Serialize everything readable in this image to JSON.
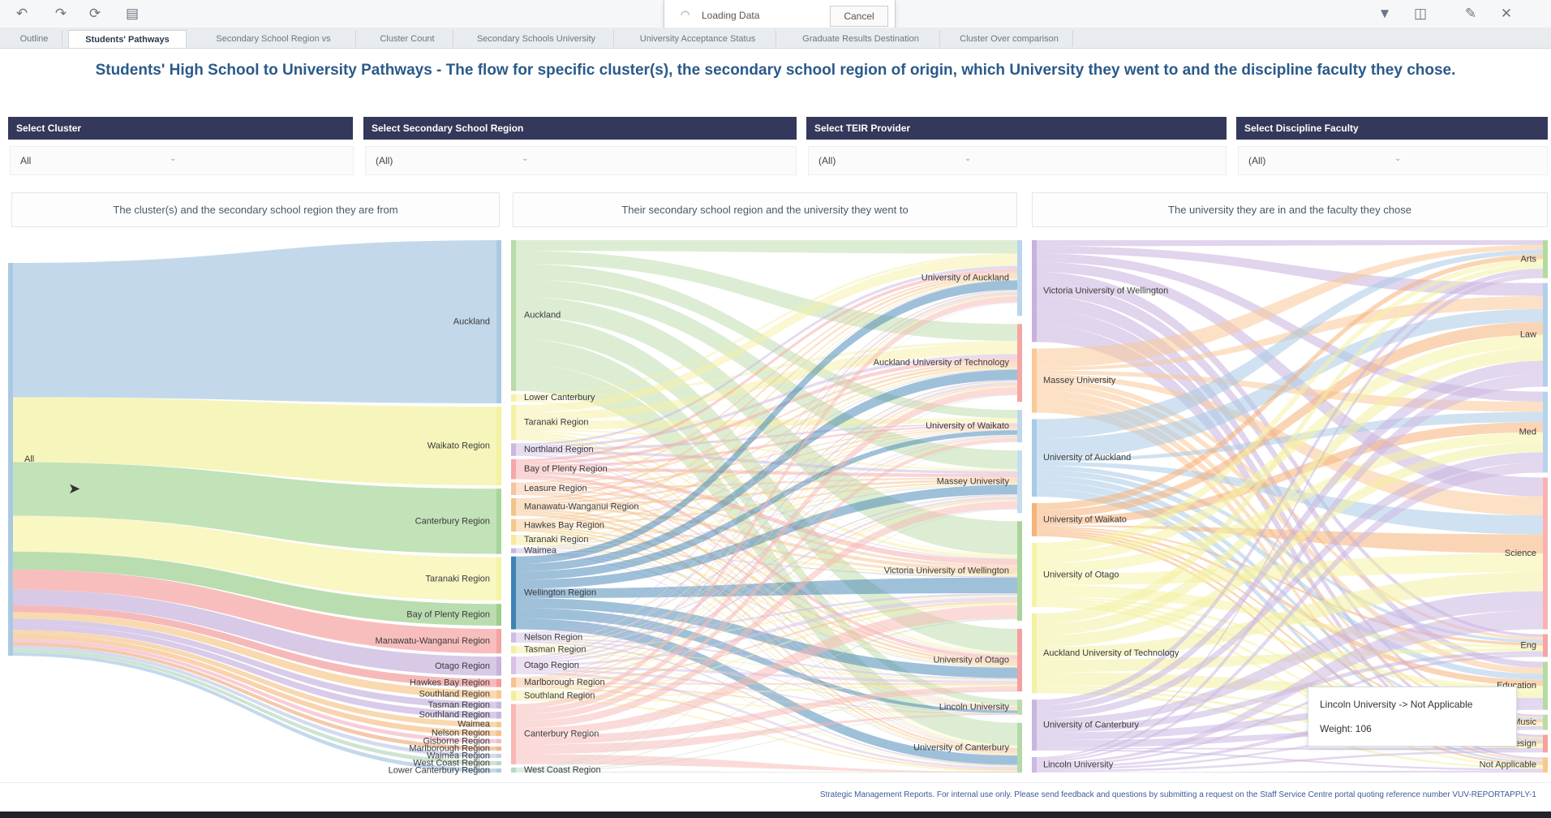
{
  "toolbar": {
    "icons": [
      "undo-icon",
      "redo-icon",
      "refresh-icon",
      "menu-icon",
      "filter-icon",
      "share-icon",
      "edit-icon",
      "close-icon"
    ]
  },
  "loading": {
    "text": "Loading Data",
    "cancel_label": "Cancel"
  },
  "tabs": [
    {
      "label": "Outline"
    },
    {
      "label": "Students' Pathways"
    },
    {
      "label": "Secondary School Region vs"
    },
    {
      "label": "Cluster Count"
    },
    {
      "label": "Secondary Schools University"
    },
    {
      "label": "University Acceptance Status"
    },
    {
      "label": "Graduate Results Destination"
    },
    {
      "label": "Cluster Over comparison"
    }
  ],
  "title": "Students' High School to University Pathways - The flow for specific cluster(s), the secondary school region of origin, which University they went to and the discipline faculty they chose.",
  "filters": [
    {
      "label": "Select Cluster",
      "value": "All"
    },
    {
      "label": "Select Secondary School Region",
      "value": "(All)"
    },
    {
      "label": "Select TEIR Provider",
      "value": "(All)"
    },
    {
      "label": "Select Discipline Faculty",
      "value": "(All)"
    }
  ],
  "panels": [
    {
      "title": "The cluster(s) and the secondary school region they are from"
    },
    {
      "title": "Their secondary school region and the university they went to"
    },
    {
      "title": "The university they are in and the faculty they chose"
    }
  ],
  "sankey": {
    "source_label": "All",
    "regions_1": [
      {
        "label": "Auckland",
        "color": "#a9c9e3",
        "value": 120
      },
      {
        "label": "Waikato Region",
        "color": "#f2f2a0",
        "value": 58
      },
      {
        "label": "Canterbury Region",
        "color": "#a8d59a",
        "value": 48
      },
      {
        "label": "Taranaki Region",
        "color": "#f6f3a8",
        "value": 32
      },
      {
        "label": "Bay of Plenty Region",
        "color": "#9ccf8e",
        "value": 16
      },
      {
        "label": "Manawatu-Wanganui Region",
        "color": "#f5a3a3",
        "value": 18
      },
      {
        "label": "Otago Region",
        "color": "#c8b2dc",
        "value": 14
      },
      {
        "label": "Hawkes Bay Region",
        "color": "#f29b9b",
        "value": 6
      },
      {
        "label": "Southland Region",
        "color": "#f7c98d",
        "value": 6
      },
      {
        "label": "Tasman Region",
        "color": "#c7b6df",
        "value": 5
      },
      {
        "label": "Southland Region",
        "color": "#c9b5e0",
        "value": 5
      },
      {
        "label": "Waimea",
        "color": "#f5c88e",
        "value": 4
      },
      {
        "label": "Nelson Region",
        "color": "#f5c08a",
        "value": 4
      },
      {
        "label": "Gisborne Region",
        "color": "#f3b8c7",
        "value": 3
      },
      {
        "label": "Marlborough Region",
        "color": "#f0b286",
        "value": 3
      },
      {
        "label": "Waimea Region",
        "color": "#c0cde8",
        "value": 3
      },
      {
        "label": "West Coast Region",
        "color": "#b8d8c0",
        "value": 3
      },
      {
        "label": "Lower Canterbury Region",
        "color": "#a9c9e3",
        "value": 3
      }
    ],
    "regions_2": [
      {
        "label": "Auckland",
        "color": "#b9dba8",
        "value": 120
      },
      {
        "label": "Lower Canterbury",
        "color": "#f5f1a6",
        "value": 6
      },
      {
        "label": "Taranaki Region",
        "color": "#f5f0a3",
        "value": 28
      },
      {
        "label": "Northland Region",
        "color": "#cbb8df",
        "value": 10
      },
      {
        "label": "Bay of Plenty Region",
        "color": "#f5a8a8",
        "value": 16
      },
      {
        "label": "Leasure Region",
        "color": "#f6c3a0",
        "value": 10
      },
      {
        "label": "Manawatu-Wanganui Region",
        "color": "#f6c28b",
        "value": 14
      },
      {
        "label": "Hawkes Bay Region",
        "color": "#f5c88e",
        "value": 10
      },
      {
        "label": "Taranaki Region",
        "color": "#f5ea9c",
        "value": 8
      },
      {
        "label": "Waimea",
        "color": "#c6b6e0",
        "value": 4
      },
      {
        "label": "Wellington Region",
        "color": "#3f82b4",
        "value": 58
      },
      {
        "label": "Nelson Region",
        "color": "#cdbce3",
        "value": 8
      },
      {
        "label": "Tasman Region",
        "color": "#f4efa0",
        "value": 6
      },
      {
        "label": "Otago Region",
        "color": "#d8c0e6",
        "value": 14
      },
      {
        "label": "Marlborough Region",
        "color": "#f6c290",
        "value": 8
      },
      {
        "label": "Southland Region",
        "color": "#f5ed9e",
        "value": 8
      },
      {
        "label": "Canterbury Region",
        "color": "#f8b8b4",
        "value": 48
      },
      {
        "label": "West Coast Region",
        "color": "#b9d8c6",
        "value": 4
      }
    ],
    "universities_mid": [
      {
        "label": "University of Auckland",
        "color": "#b9d6ec",
        "value": 70
      },
      {
        "label": "Auckland University of Technology",
        "color": "#f6a6a2",
        "value": 72
      },
      {
        "label": "University of Waikato",
        "color": "#bdd8ec",
        "value": 30
      },
      {
        "label": "Massey University",
        "color": "#c6dcef",
        "value": 58
      },
      {
        "label": "Victoria University of Wellington",
        "color": "#a9d59a",
        "value": 92
      },
      {
        "label": "University of Otago",
        "color": "#f4a0a0",
        "value": 58
      },
      {
        "label": "Lincoln University",
        "color": "#b9dba8",
        "value": 14
      },
      {
        "label": "University of Canterbury",
        "color": "#b3daa6",
        "value": 46
      }
    ],
    "universities_right": [
      {
        "label": "Victoria University of Wellington",
        "color": "#c8b0df",
        "value": 92
      },
      {
        "label": "Massey University",
        "color": "#f9c997",
        "value": 58
      },
      {
        "label": "University of Auckland",
        "color": "#a9cbe6",
        "value": 70
      },
      {
        "label": "University of Waikato",
        "color": "#f6b378",
        "value": 30
      },
      {
        "label": "University of Otago",
        "color": "#f6f3a4",
        "value": 58
      },
      {
        "label": "Auckland University of Technology",
        "color": "#f3f1a2",
        "value": 72
      },
      {
        "label": "University of Canterbury",
        "color": "#c9b6e0",
        "value": 46
      },
      {
        "label": "Lincoln University",
        "color": "#cdb8e2",
        "value": 14
      }
    ],
    "faculties": [
      {
        "label": "Arts",
        "color": "#b3dba0",
        "value": 30
      },
      {
        "label": "Law",
        "color": "#b1d0ea",
        "value": 82
      },
      {
        "label": "Med",
        "color": "#b6d3ec",
        "value": 64
      },
      {
        "label": "Science",
        "color": "#f8b3b0",
        "value": 120
      },
      {
        "label": "Eng",
        "color": "#f6a4a4",
        "value": 18
      },
      {
        "label": "Education",
        "color": "#b4dba0",
        "value": 38
      },
      {
        "label": "Music",
        "color": "#b9dba8",
        "value": 12
      },
      {
        "label": "Design",
        "color": "#f4a0a0",
        "value": 14
      },
      {
        "label": "Not Applicable",
        "color": "#f8c88e",
        "value": 12
      }
    ]
  },
  "tooltip": {
    "line1": "Lincoln University -> Not Applicable",
    "line2": "Weight: 106"
  },
  "footer": "Strategic Management Reports. For internal use only. Please send feedback and questions by submitting a request on the Staff Service Centre portal quoting reference number VUV-REPORTAPPLY-1"
}
